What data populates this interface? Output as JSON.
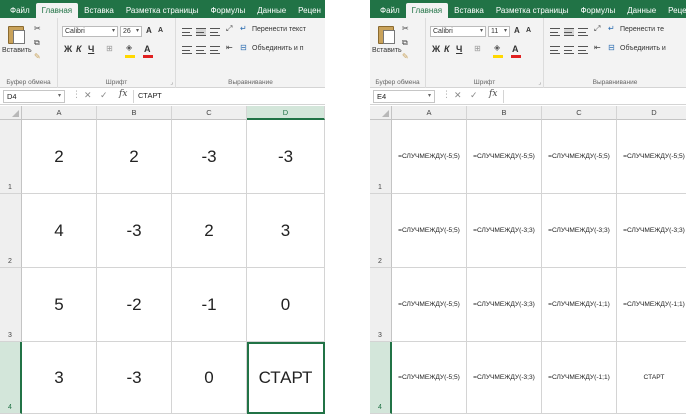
{
  "ribbon_tabs": [
    "Файл",
    "Главная",
    "Вставка",
    "Разметка страницы",
    "Формулы",
    "Данные",
    "Рецен"
  ],
  "ribbon_tabs_right": [
    "Файл",
    "Главная",
    "Вставка",
    "Разметка страницы",
    "Формулы",
    "Данные",
    "Реце"
  ],
  "active_tab": "Главная",
  "clipboard": {
    "paste_label": "Вставить",
    "group_label": "Буфер обмена"
  },
  "font": {
    "group_label": "Шрифт",
    "bold": "Ж",
    "italic": "К",
    "underline": "Ч",
    "increase": "A",
    "decrease": "A"
  },
  "left_font": {
    "name": "Calibri",
    "size": "26"
  },
  "right_font": {
    "name": "Calibri",
    "size": "11"
  },
  "alignment": {
    "group_label": "Выравнивание",
    "wrap_label": "Перенести текст",
    "merge_label": "Объединить и п"
  },
  "alignment_right": {
    "wrap_label": "Перенести те",
    "merge_label": "Объединить и"
  },
  "left_formula": {
    "cell_ref": "D4",
    "content": "СТАРТ"
  },
  "right_formula": {
    "cell_ref": "E4",
    "content": ""
  },
  "columns": [
    "A",
    "B",
    "C",
    "D"
  ],
  "rows": [
    "1",
    "2",
    "3",
    "4"
  ],
  "left_values": [
    [
      "2",
      "2",
      "-3",
      "-3"
    ],
    [
      "4",
      "-3",
      "2",
      "3"
    ],
    [
      "5",
      "-2",
      "-1",
      "0"
    ],
    [
      "3",
      "-3",
      "0",
      "СТАРТ"
    ]
  ],
  "right_formulas": [
    [
      "=СЛУЧМЕЖДУ(-5;5)",
      "=СЛУЧМЕЖДУ(-5;5)",
      "=СЛУЧМЕЖДУ(-5;5)",
      "=СЛУЧМЕЖДУ(-5;5)"
    ],
    [
      "=СЛУЧМЕЖДУ(-5;5)",
      "=СЛУЧМЕЖДУ(-3;3)",
      "=СЛУЧМЕЖДУ(-3;3)",
      "=СЛУЧМЕЖДУ(-3;3)"
    ],
    [
      "=СЛУЧМЕЖДУ(-5;5)",
      "=СЛУЧМЕЖДУ(-3;3)",
      "=СЛУЧМЕЖДУ(-1;1)",
      "=СЛУЧМЕЖДУ(-1;1)"
    ],
    [
      "=СЛУЧМЕЖДУ(-5;5)",
      "=СЛУЧМЕЖДУ(-3;3)",
      "=СЛУЧМЕЖДУ(-1;1)",
      "СТАРТ"
    ]
  ],
  "colors": {
    "excel_green": "#217346",
    "selection_header": "#d3e6da",
    "ribbon_bg": "#f3f3f3",
    "highlight_yellow": "#ffd800",
    "font_red": "#e02020"
  },
  "icons": [
    "cut-icon",
    "copy-icon",
    "format-painter-icon",
    "paste-icon",
    "borders-icon",
    "fill-color-icon",
    "font-color-icon",
    "wrap-text-icon",
    "merge-icon",
    "cancel-icon",
    "enter-icon",
    "function-icon"
  ]
}
